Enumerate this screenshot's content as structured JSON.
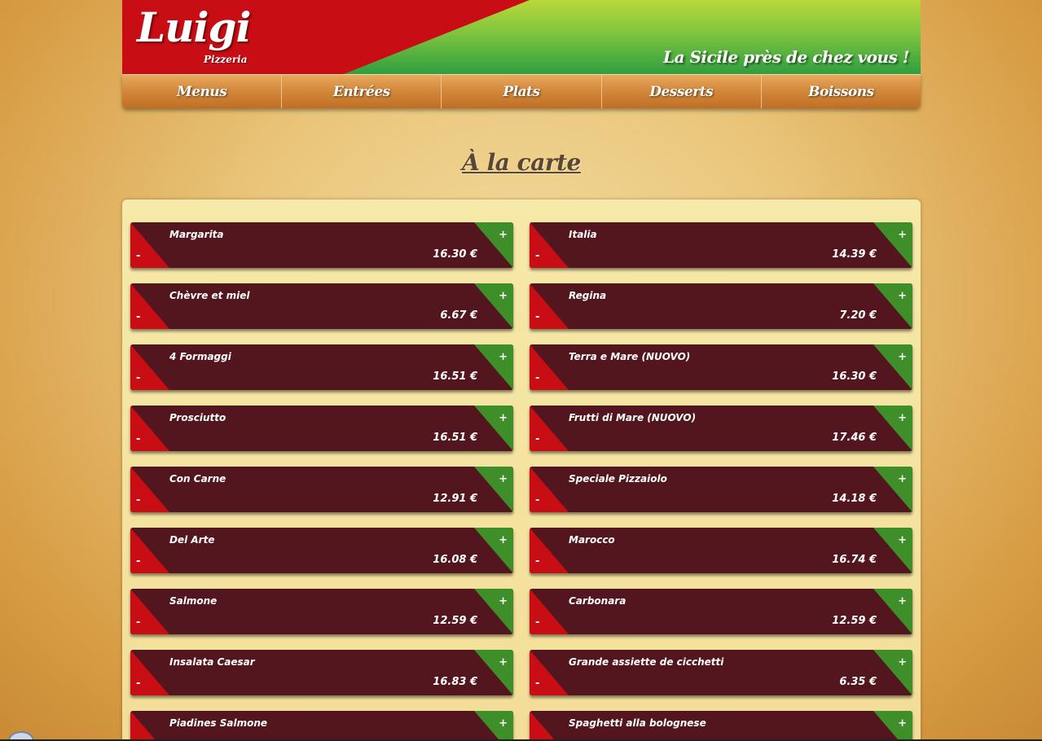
{
  "header": {
    "logo": "Luigi",
    "logo_sub": "Pizzeria",
    "tagline": "La Sicile près de chez vous !",
    "colors": {
      "red": "#c80d14",
      "green": "#2f9f3f",
      "lime": "#b9d83a"
    }
  },
  "nav": {
    "items": [
      {
        "label": "Menus"
      },
      {
        "label": "Entrées"
      },
      {
        "label": "Plats"
      },
      {
        "label": "Desserts"
      },
      {
        "label": "Boissons"
      }
    ]
  },
  "main": {
    "title": "À la carte",
    "minus_label": "-",
    "plus_label": "+",
    "items": [
      {
        "name": "Margarita",
        "price": "16.30 €"
      },
      {
        "name": "Italia",
        "price": "14.39 €"
      },
      {
        "name": "Chèvre et miel",
        "price": "6.67 €"
      },
      {
        "name": "Regina",
        "price": "7.20 €"
      },
      {
        "name": "4 Formaggi",
        "price": "16.51 €"
      },
      {
        "name": "Terra e Mare (NUOVO)",
        "price": "16.30 €"
      },
      {
        "name": "Prosciutto",
        "price": "16.51 €"
      },
      {
        "name": "Frutti di Mare (NUOVO)",
        "price": "17.46 €"
      },
      {
        "name": "Con Carne",
        "price": "12.91 €"
      },
      {
        "name": "Speciale Pizzaiolo",
        "price": "14.18 €"
      },
      {
        "name": "Del Arte",
        "price": "16.08 €"
      },
      {
        "name": "Marocco",
        "price": "16.74 €"
      },
      {
        "name": "Salmone",
        "price": "12.59 €"
      },
      {
        "name": "Carbonara",
        "price": "12.59 €"
      },
      {
        "name": "Insalata Caesar",
        "price": "16.83 €"
      },
      {
        "name": "Grande assiette de cicchetti",
        "price": "6.35 €"
      },
      {
        "name": "Piadines Salmone",
        "price": ""
      },
      {
        "name": "Spaghetti alla bolognese",
        "price": ""
      }
    ]
  }
}
